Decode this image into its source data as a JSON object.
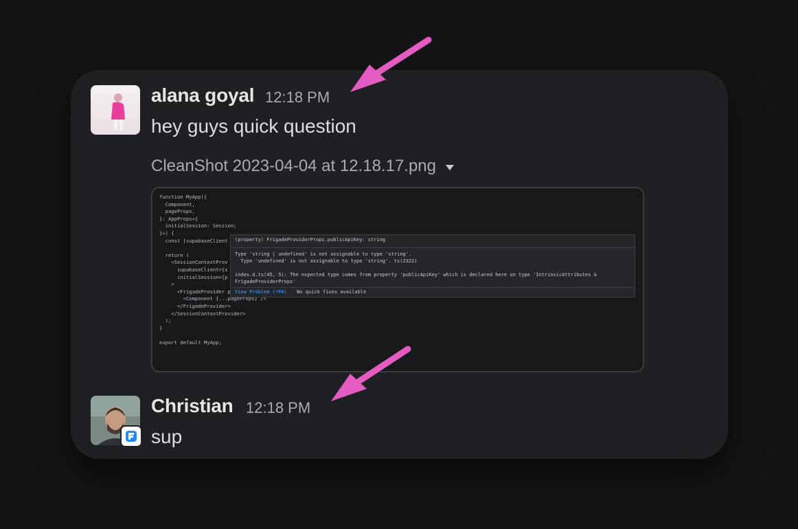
{
  "message1": {
    "author": "alana goyal",
    "time": "12:18 PM",
    "text": "hey guys quick question",
    "attachment": {
      "filename": "CleanShot 2023-04-04 at 12.18.17.png",
      "code_lines": [
        "function MyApp({",
        "  Component,",
        "  pageProps,",
        "}: AppProps<{",
        "  initialSession: Session;",
        "}>) {",
        "  const [supabaseClient",
        "",
        "  return (",
        "    <SessionContextProv",
        "      supabaseClient={s",
        "      initialSession={p",
        "    >",
        "      <FrigadeProvider publicApiKey={process.env.FRIGADE_API_KEY}>",
        "        <Component {...pageProps} />",
        "      </FrigadeProvider>",
        "    </SessionContextProvider>",
        "  );",
        "}",
        "",
        "export default MyApp;"
      ],
      "tooltip": {
        "header": "(property) FrigadeProviderProps.publicApiKey: string",
        "body_lines": [
          "Type 'string | undefined' is not assignable to type 'string'.",
          "  Type 'undefined' is not assignable to type 'string'. ts(2322)",
          "",
          "index.d.ts(45, 5): The expected type comes from property 'publicApiKey' which is declared here on type 'IntrinsicAttributes &",
          "FrigadeProviderProps'"
        ],
        "view_problem": "View Problem (⌥F8)",
        "no_fixes": "No quick fixes available"
      }
    }
  },
  "message2": {
    "author": "Christian",
    "time": "12:18 PM",
    "text": "sup"
  },
  "colors": {
    "arrow": "#e45bc2",
    "card": "#1f2024",
    "background": "#141416"
  },
  "icons": {
    "dropdown": "caret-down-icon",
    "badge": "frigade-logo-icon"
  }
}
